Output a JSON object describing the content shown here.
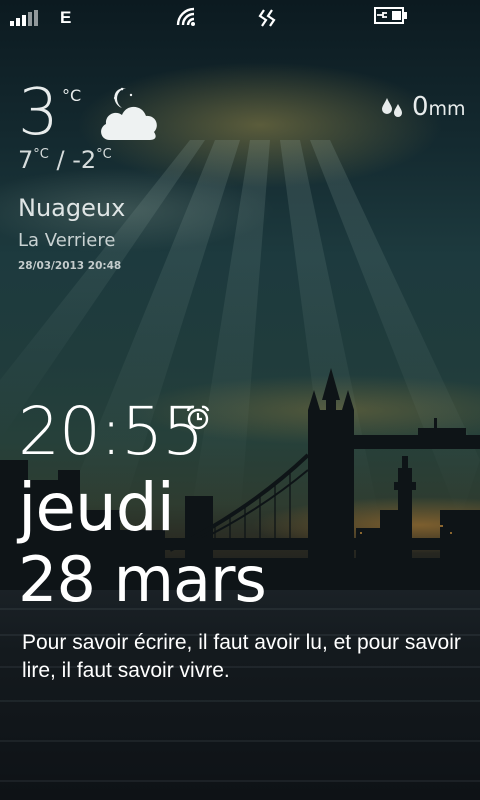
{
  "status_bar": {
    "signal_icon": "signal-strength-icon",
    "network_type": "E",
    "wifi_icon": "wifi-icon",
    "sync_icon": "data-sync-icon",
    "battery_icon": "battery-charging-icon"
  },
  "weather": {
    "current_temp": "3",
    "temp_unit": "°C",
    "condition_icon": "partly-cloudy-night-icon",
    "high": "7",
    "low": "-2",
    "high_unit": "°C",
    "low_unit": "°C",
    "range_separator": "/",
    "precip_icon": "raindrops-icon",
    "precip_amount": "0",
    "precip_unit": "mm",
    "condition": "Nuageux",
    "location": "La Verriere",
    "updated": "28/03/2013 20:48"
  },
  "clock": {
    "time": "20:55",
    "alarm_icon": "alarm-clock-icon",
    "weekday": "jeudi",
    "date": "28 mars"
  },
  "quote": "Pour savoir écrire, il faut avoir lu, et pour savoir lire, il faut savoir vivre."
}
